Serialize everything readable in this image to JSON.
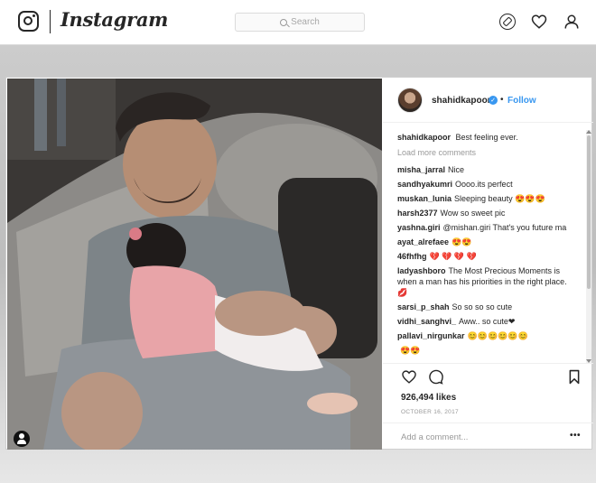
{
  "nav": {
    "brand": "Instagram",
    "search_placeholder": "Search"
  },
  "post": {
    "author": "shahidkapoor",
    "verified_mark": "✓",
    "separator": "•",
    "follow_label": "Follow",
    "caption": "Best feeling ever.",
    "load_more": "Load more comments",
    "comments": [
      {
        "user": "misha_jarral",
        "text": "Nice"
      },
      {
        "user": "sandhyakumri",
        "text": "Oooo.its perfect"
      },
      {
        "user": "muskan_lunia",
        "text": "Sleeping beauty 😍😍😍"
      },
      {
        "user": "harsh2377",
        "text": "Wow so sweet pic"
      },
      {
        "user": "yashna.giri",
        "text": "@mishan.giri That's you future ma"
      },
      {
        "user": "ayat_alrefaee",
        "text": "😍😍"
      },
      {
        "user": "46fhfhg",
        "text": "💔 💔 💔 💔"
      },
      {
        "user": "ladyashboro",
        "text": "The Most Precious Moments is when a man has his priorities in the right place. 💋"
      },
      {
        "user": "sarsi_p_shah",
        "text": "So so so so cute"
      },
      {
        "user": "vidhi_sanghvi_",
        "text": "Aww.. so cute❤"
      },
      {
        "user": "pallavi_nirgunkar",
        "text": "😊😊😊😊😊😊"
      },
      {
        "user": "",
        "text": "😍😍"
      }
    ],
    "likes": "926,494 likes",
    "date": "OCTOBER 16, 2017",
    "add_comment_placeholder": "Add a comment...",
    "more_options": "•••"
  },
  "colors": {
    "link": "#3897f0",
    "text": "#262626",
    "muted": "#999999",
    "border": "#dbdbdb"
  },
  "icons": [
    "instagram-logo-icon",
    "search-icon",
    "explore-compass-icon",
    "heart-icon",
    "profile-icon",
    "user-tag-icon",
    "verified-badge-icon",
    "like-heart-icon",
    "comment-bubble-icon",
    "bookmark-icon"
  ]
}
